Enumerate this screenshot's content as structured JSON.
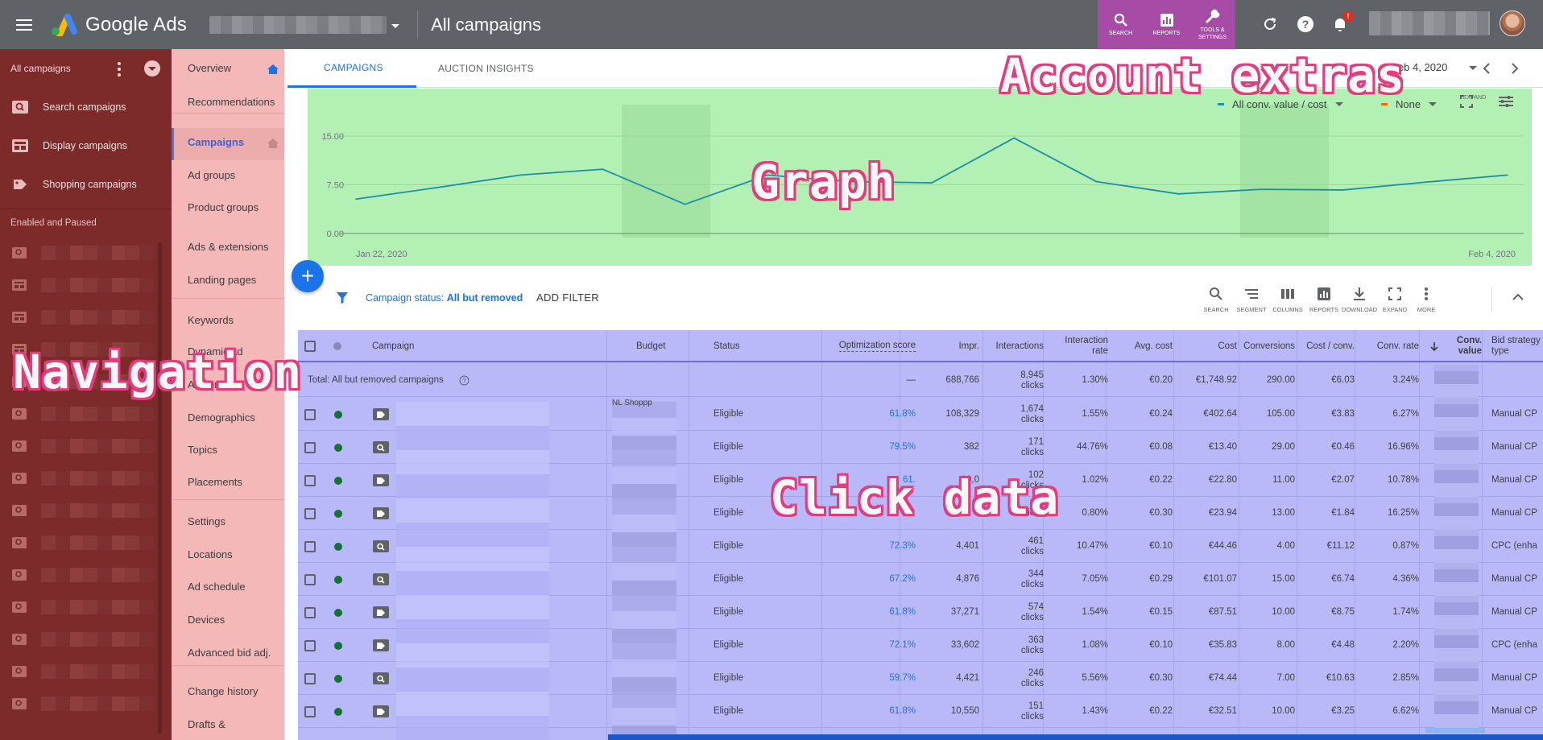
{
  "app": {
    "name": "Google Ads",
    "page_title": "All campaigns"
  },
  "topbar": {
    "tools": [
      {
        "label": "SEARCH",
        "icon": "search-icon"
      },
      {
        "label": "REPORTS",
        "icon": "reports-icon"
      },
      {
        "label": "TOOLS & SETTINGS",
        "icon": "wrench-icon"
      }
    ],
    "notification_count": "!"
  },
  "nav": {
    "header": "All campaigns",
    "items": [
      {
        "label": "Search campaigns",
        "icon": "search-campaign-icon"
      },
      {
        "label": "Display campaigns",
        "icon": "display-campaign-icon"
      },
      {
        "label": "Shopping campaigns",
        "icon": "shopping-campaign-icon"
      }
    ],
    "section_label": "Enabled and Paused"
  },
  "pagemenu": {
    "items": [
      "Overview",
      "Recommendations",
      "Campaigns",
      "Ad groups",
      "Product groups",
      "Ads & extensions",
      "Landing pages",
      "Keywords",
      "Dynamic ad",
      "Audiences",
      "Demographics",
      "Topics",
      "Placements",
      "Settings",
      "Locations",
      "Ad schedule",
      "Devices",
      "Advanced bid adj.",
      "Change history",
      "Drafts &"
    ],
    "active": "Campaigns"
  },
  "tabs": [
    {
      "label": "CAMPAIGNS",
      "active": true
    },
    {
      "label": "AUCTION INSIGHTS",
      "active": false
    }
  ],
  "date_range": "Feb 4, 2020",
  "graph": {
    "metric1": "All conv. value / cost",
    "metric2": "None",
    "expand_label": "EXPAND",
    "colors": {
      "metric1": "#1a8fa8",
      "metric2": "#e8710a",
      "panel": "#b3f0b3"
    }
  },
  "chart_data": {
    "type": "line",
    "series": [
      {
        "values": [
          5.3,
          7.1,
          9.0,
          9.9,
          4.5,
          9.0,
          8.0,
          7.8,
          14.7,
          8.0,
          6.1,
          6.8,
          6.7,
          7.9,
          9.0
        ]
      }
    ],
    "x": [
      "Jan 22, 2020",
      "Jan 23, 2020",
      "Jan 24, 2020",
      "Jan 25, 2020",
      "Jan 26, 2020",
      "Jan 27, 2020",
      "Jan 28, 2020",
      "Jan 29, 2020",
      "Jan 30, 2020",
      "Jan 31, 2020",
      "Feb 1, 2020",
      "Feb 2, 2020",
      "Feb 3, 2020",
      "Feb 3, 2020",
      "Feb 4, 2020"
    ],
    "x_ticks": [
      "Jan 22, 2020",
      "Feb 4, 2020"
    ],
    "y_ticks": [
      "15.00",
      "7.50",
      "0.00"
    ],
    "ylim": [
      0,
      15
    ],
    "grid": true
  },
  "filter": {
    "prefix": "Campaign status: ",
    "value": "All but removed",
    "add_label": "ADD FILTER"
  },
  "toolbar": [
    {
      "label": "SEARCH",
      "icon": "search-icon"
    },
    {
      "label": "SEGMENT",
      "icon": "segment-icon"
    },
    {
      "label": "COLUMNS",
      "icon": "columns-icon"
    },
    {
      "label": "REPORTS",
      "icon": "reports-icon"
    },
    {
      "label": "DOWNLOAD",
      "icon": "download-icon"
    },
    {
      "label": "EXPAND",
      "icon": "expand-icon"
    },
    {
      "label": "MORE",
      "icon": "more-icon"
    }
  ],
  "table": {
    "headers": {
      "campaign": "Campaign",
      "budget": "Budget",
      "status": "Status",
      "opt_score": "Optimization score",
      "impr": "Impr.",
      "interactions": "Interactions",
      "interaction_rate": "Interaction rate",
      "avg_cost": "Avg. cost",
      "cost": "Cost",
      "conversions": "Conversions",
      "cost_conv": "Cost / conv.",
      "conv_rate": "Conv. rate",
      "conv_value": "Conv. value",
      "bid_strategy": "Bid strategy type"
    },
    "total": {
      "label": "Total: All but removed campaigns",
      "opt_score": "—",
      "impr": "688,766",
      "interactions": "8,945",
      "interactions_unit": "clicks",
      "interaction_rate": "1.30%",
      "avg_cost": "€0.20",
      "cost": "€1,748.92",
      "conversions": "290.00",
      "cost_conv": "€6.03",
      "conv_rate": "3.24%"
    },
    "budget_fragment": "NL Shoppp",
    "rows": [
      {
        "type": "shopping",
        "status": "Eligible",
        "opt": "61.8%",
        "impr": "108,329",
        "inter": "1,674",
        "unit": "clicks",
        "rate": "1.55%",
        "avg": "€0.24",
        "cost": "€402.64",
        "conv": "105.00",
        "cpc": "€3.83",
        "cr": "6.27%",
        "bid": "Manual CP"
      },
      {
        "type": "search",
        "status": "Eligible",
        "opt": "79.5%",
        "impr": "382",
        "inter": "171",
        "unit": "clicks",
        "rate": "44.76%",
        "avg": "€0.08",
        "cost": "€13.40",
        "conv": "29.00",
        "cpc": "€0.46",
        "cr": "16.96%",
        "bid": "Manual CP"
      },
      {
        "type": "shopping",
        "status": "Eligible",
        "opt": "61.",
        "impr": "10,0",
        "inter": "102",
        "unit": "clicks",
        "rate": "1.02%",
        "avg": "€0.22",
        "cost": "€22.80",
        "conv": "11.00",
        "cpc": "€2.07",
        "cr": "10.78%",
        "bid": "Manual CP"
      },
      {
        "type": "shopping",
        "status": "Eligible",
        "opt": "",
        "impr": "",
        "inter": "",
        "unit": "clicks",
        "rate": "0.80%",
        "avg": "€0.30",
        "cost": "€23.94",
        "conv": "13.00",
        "cpc": "€1.84",
        "cr": "16.25%",
        "bid": "Manual CP"
      },
      {
        "type": "search",
        "status": "Eligible",
        "opt": "72.3%",
        "impr": "4,401",
        "inter": "461",
        "unit": "clicks",
        "rate": "10.47%",
        "avg": "€0.10",
        "cost": "€44.46",
        "conv": "4.00",
        "cpc": "€11.12",
        "cr": "0.87%",
        "bid": "CPC (enha"
      },
      {
        "type": "search",
        "status": "Eligible",
        "opt": "67.2%",
        "impr": "4,876",
        "inter": "344",
        "unit": "clicks",
        "rate": "7.05%",
        "avg": "€0.29",
        "cost": "€101.07",
        "conv": "15.00",
        "cpc": "€6.74",
        "cr": "4.36%",
        "bid": "Manual CP"
      },
      {
        "type": "shopping",
        "status": "Eligible",
        "opt": "61.8%",
        "impr": "37,271",
        "inter": "574",
        "unit": "clicks",
        "rate": "1.54%",
        "avg": "€0.15",
        "cost": "€87.51",
        "conv": "10.00",
        "cpc": "€8.75",
        "cr": "1.74%",
        "bid": "Manual CP"
      },
      {
        "type": "shopping",
        "status": "Eligible",
        "opt": "72.1%",
        "impr": "33,602",
        "inter": "363",
        "unit": "clicks",
        "rate": "1.08%",
        "avg": "€0.10",
        "cost": "€35.83",
        "conv": "8.00",
        "cpc": "€4.48",
        "cr": "2.20%",
        "bid": "CPC (enha"
      },
      {
        "type": "search",
        "status": "Eligible",
        "opt": "59.7%",
        "impr": "4,421",
        "inter": "246",
        "unit": "clicks",
        "rate": "5.56%",
        "avg": "€0.30",
        "cost": "€74.44",
        "conv": "7.00",
        "cpc": "€10.63",
        "cr": "2.85%",
        "bid": "Manual CP"
      },
      {
        "type": "shopping",
        "status": "Eligible",
        "opt": "61.8%",
        "impr": "10,550",
        "inter": "151",
        "unit": "clicks",
        "rate": "1.43%",
        "avg": "€0.22",
        "cost": "€32.51",
        "conv": "10.00",
        "cpc": "€3.25",
        "cr": "6.62%",
        "bid": "Manual CP"
      }
    ]
  },
  "overlays": {
    "account_extras": "Account extras",
    "graph": "Graph",
    "navigation": "Navigation",
    "click_data": "Click data"
  }
}
